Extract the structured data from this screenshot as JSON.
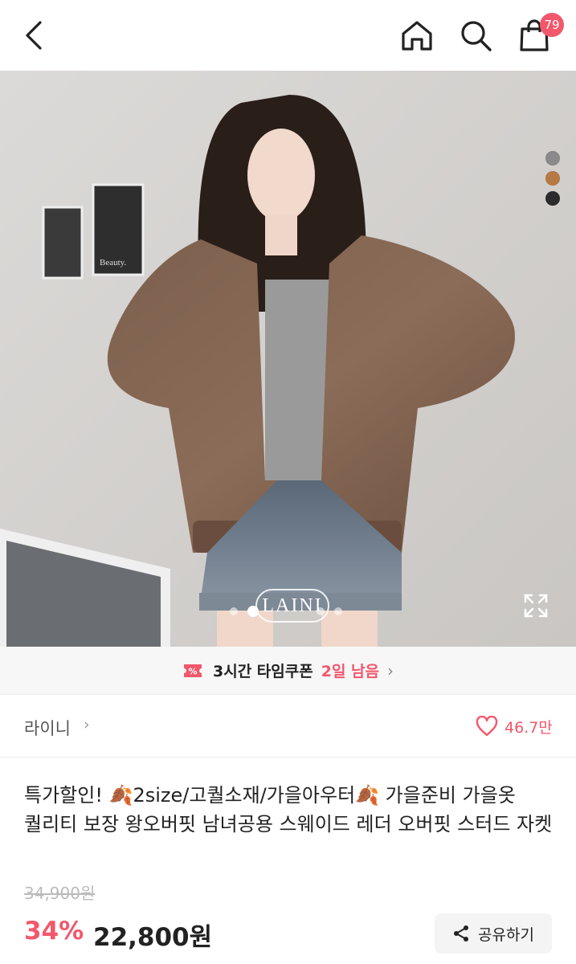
{
  "header": {
    "cart_count": "79",
    "icons": [
      "back-icon",
      "home-icon",
      "search-icon",
      "shopping-bag-icon"
    ]
  },
  "hero": {
    "watermark": "LAINI",
    "photo_label": "Beauty.",
    "color_options": [
      "#8a8a8a",
      "#b87a45",
      "#2b2b2b"
    ],
    "page_count": 4,
    "active_page": 2
  },
  "coupon": {
    "label": "3시간 타임쿠폰",
    "remaining": "2일 남음",
    "chevron": "›"
  },
  "store": {
    "name": "라이니",
    "chevron": "›",
    "likes": "46.7만"
  },
  "product": {
    "title": "특가할인! 🍂2size/고퀄소재/가을아우터🍂 가을준비 가을옷 퀄리티 보장 왕오버핏 남녀공용 스웨이드 레더 오버핏 스터드 자켓",
    "original_price": "34,900원",
    "discount": "34%",
    "price": "22,800원",
    "share_label": "공유하기"
  },
  "colors": {
    "accent": "#f2576b",
    "text": "#222222"
  }
}
